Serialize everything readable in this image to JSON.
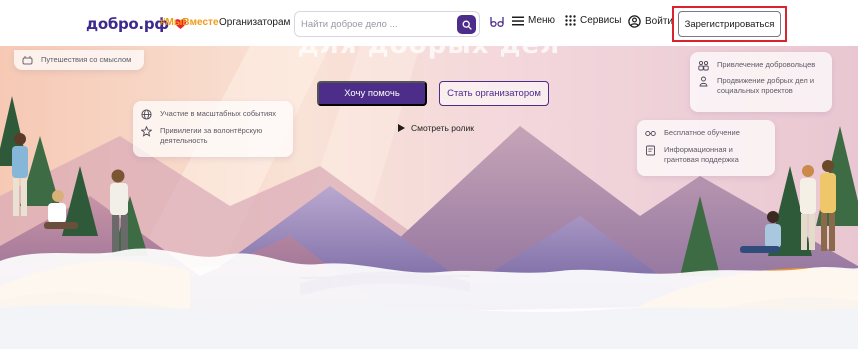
{
  "header": {
    "logo_text": "добро.рф",
    "hashtag": "#МыВместе",
    "nav_organizers": "Организаторам",
    "search_placeholder": "Найти доброе дело ...",
    "menu_label": "Меню",
    "services_label": "Сервисы",
    "login_label": "Войти",
    "register_label": "Зарегистрироваться"
  },
  "hero": {
    "title": "для добрых дел",
    "help_button": "Хочу помочь",
    "organizer_button": "Стать организатором",
    "watch_video": "Смотреть ролик",
    "cards": {
      "travel": "Путешествия со смыслом",
      "events": "Участие в масштабных событиях",
      "privileges": "Привилегии за волонтёрскую деятельность",
      "volunteers": "Привлечение добровольцев",
      "promotion": "Продвижение добрых дел и социальных проектов",
      "learning": "Бесплатное обучение",
      "grant": "Информационная и грантовая поддержка"
    }
  },
  "colors": {
    "brand_purple": "#4c2d8a",
    "hashtag_orange": "#f29a16",
    "highlight_red": "#d9232e"
  },
  "icons": [
    "heart-logo-icon",
    "search-icon",
    "accessibility-eyes-icon",
    "menu-icon",
    "services-grid-icon",
    "user-icon",
    "play-icon",
    "travel-icon",
    "globe-icon",
    "star-icon",
    "people-icon",
    "megaphone-icon",
    "glasses-icon",
    "document-icon"
  ]
}
